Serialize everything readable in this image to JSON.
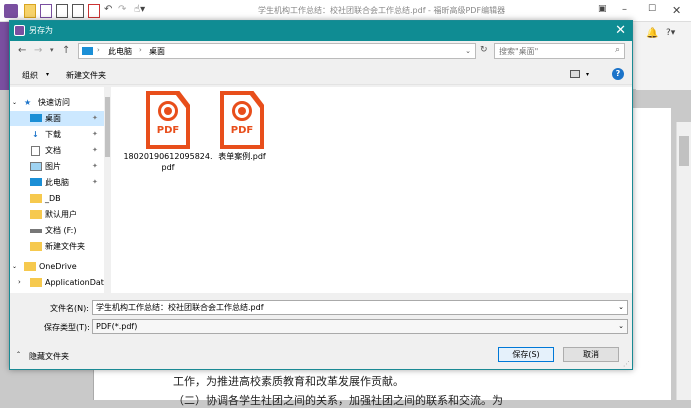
{
  "app": {
    "title": "学生机构工作总结：校社团联合会工作总结.pdf - 福昕高级PDF编辑器"
  },
  "document": {
    "lines": [
      "工作，为推进高校素质教育和改革发展作贡献。",
      "（二）协调各学生社团之间的关系，加强社团之间的联系和交流。为"
    ]
  },
  "dialog": {
    "title": "另存为",
    "breadcrumb": [
      "此电脑",
      "桌面"
    ],
    "search_placeholder": "搜索\"桌面\"",
    "toolbar": {
      "organize": "组织",
      "new_folder": "新建文件夹"
    },
    "nav": [
      {
        "label": "快速访问",
        "icon": "star-icon",
        "selected": false,
        "pinned": false
      },
      {
        "label": "桌面",
        "icon": "desktop-icon",
        "selected": true,
        "pinned": true
      },
      {
        "label": "下载",
        "icon": "download-icon",
        "selected": false,
        "pinned": true
      },
      {
        "label": "文档",
        "icon": "document-icon",
        "selected": false,
        "pinned": true
      },
      {
        "label": "图片",
        "icon": "picture-icon",
        "selected": false,
        "pinned": true
      },
      {
        "label": "此电脑",
        "icon": "computer-icon",
        "selected": false,
        "pinned": true
      },
      {
        "label": "_DB",
        "icon": "folder-icon",
        "selected": false,
        "pinned": false
      },
      {
        "label": "默认用户",
        "icon": "folder-icon",
        "selected": false,
        "pinned": false
      },
      {
        "label": "文档 (F:)",
        "icon": "drive-icon",
        "selected": false,
        "pinned": false
      },
      {
        "label": "新建文件夹",
        "icon": "folder-icon",
        "selected": false,
        "pinned": false
      },
      {
        "label": "OneDrive",
        "icon": "folder-icon",
        "selected": false,
        "pinned": false
      },
      {
        "label": "ApplicationDat",
        "icon": "folder-icon",
        "selected": false,
        "pinned": false
      }
    ],
    "files": [
      {
        "name": "18020190612095824.pdf",
        "icon": "pdf-file-icon"
      },
      {
        "name": "表单案例.pdf",
        "icon": "pdf-file-icon"
      }
    ],
    "filename_label": "文件名(N):",
    "filename_value": "学生机构工作总结：校社团联合会工作总结.pdf",
    "filetype_label": "保存类型(T):",
    "filetype_value": "PDF(*.pdf)",
    "hide_folders": "隐藏文件夹",
    "save_button": "保存(S)",
    "cancel_button": "取消",
    "help_icon": "?"
  },
  "colors": {
    "dialog_titlebar": "#0f8c93",
    "pdf_accent": "#e84e1b",
    "selection": "#cce8ff"
  }
}
